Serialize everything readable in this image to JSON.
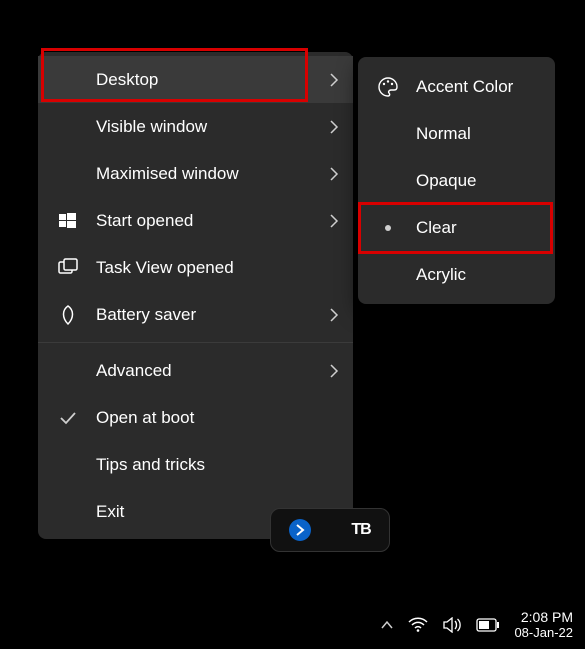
{
  "main_menu": {
    "desktop": "Desktop",
    "visible_window": "Visible window",
    "maximised_window": "Maximised window",
    "start_opened": "Start opened",
    "task_view_opened": "Task View opened",
    "battery_saver": "Battery saver",
    "advanced": "Advanced",
    "open_at_boot": "Open at boot",
    "tips_and_tricks": "Tips and tricks",
    "exit": "Exit"
  },
  "sub_menu": {
    "title": "Accent Color",
    "normal": "Normal",
    "opaque": "Opaque",
    "clear": "Clear",
    "acrylic": "Acrylic"
  },
  "taskbar": {
    "time": "2:08 PM",
    "date": "08-Jan-22"
  }
}
